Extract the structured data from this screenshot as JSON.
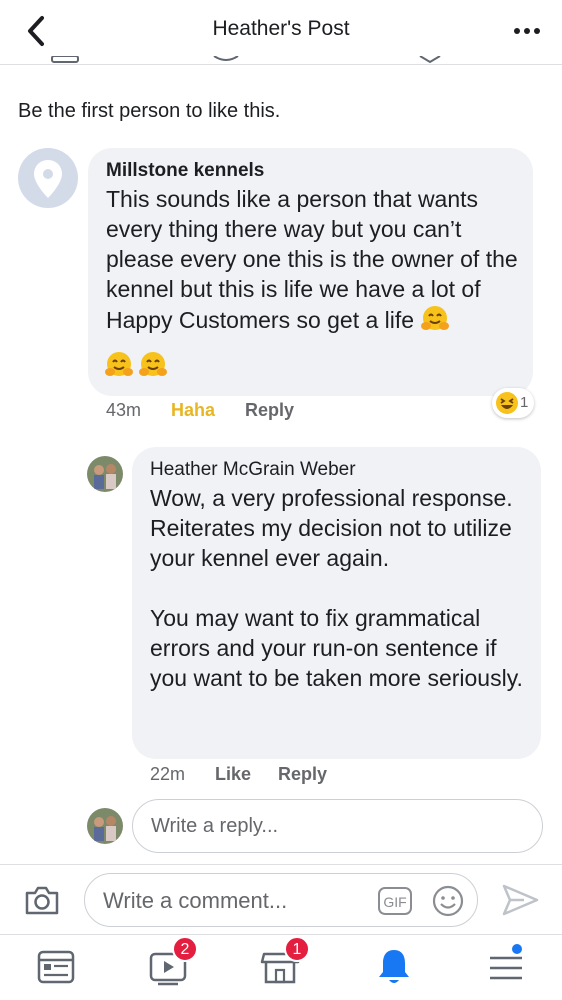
{
  "header": {
    "title": "Heather's Post"
  },
  "post": {
    "likes_summary": "Be the first person to like this."
  },
  "comments": [
    {
      "author": "Millstone kennels",
      "text": "This sounds like a person that wants every thing there way but you can’t please every one this is the owner of the kennel but this is life we have a lot of Happy Customers so get a life",
      "time": "43m",
      "reaction_label": "Haha",
      "reply_label": "Reply",
      "reaction_count": "1",
      "reaction_icon": "laughing-emoji-icon"
    }
  ],
  "replies": [
    {
      "author": "Heather McGrain Weber",
      "text": "Wow, a very professional response.  Reiterates my decision not to utilize your kennel  ever again.\n\nYou may want to fix grammatical errors and your run-on sentence if you want to be taken more seriously.",
      "time": "22m",
      "like_label": "Like",
      "reply_label": "Reply"
    }
  ],
  "reply_input": {
    "placeholder": "Write a reply..."
  },
  "composer": {
    "placeholder": "Write a comment...",
    "gif_label": "GIF"
  },
  "nav": {
    "items": [
      {
        "icon": "news-feed-icon",
        "badge": ""
      },
      {
        "icon": "watch-video-icon",
        "badge": "2"
      },
      {
        "icon": "marketplace-icon",
        "badge": "1"
      },
      {
        "icon": "notifications-bell-icon",
        "badge": ""
      },
      {
        "icon": "menu-icon",
        "badge": ""
      }
    ]
  },
  "colors": {
    "accent": "#1877f2",
    "haha": "#e8b623",
    "badge": "#e41e3f",
    "bubble": "#f0f2f5"
  }
}
